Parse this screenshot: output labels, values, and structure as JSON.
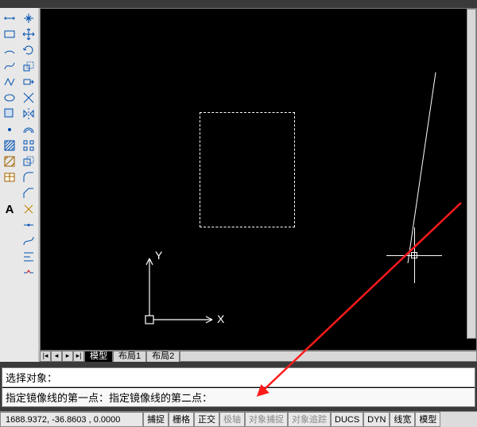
{
  "tabs": {
    "model": "模型",
    "layout1": "布局1",
    "layout2": "布局2"
  },
  "ucs": {
    "x_label": "X",
    "y_label": "Y"
  },
  "command": {
    "history1": "选择对象：",
    "prompt": "指定镜像线的第一点：指定镜像线的第二点："
  },
  "status": {
    "coords": "1688.9372, -36.8603 , 0.0000",
    "snap": "捕捉",
    "grid": "栅格",
    "ortho": "正交",
    "polar": "极轴",
    "osnap": "对象捕捉",
    "otrack": "对象追踪",
    "ducs": "DUCS",
    "dyn": "DYN",
    "lwt": "线宽",
    "model": "模型"
  },
  "nav": {
    "first": "|◂",
    "prev": "◂",
    "next": "▸",
    "last": "▸|"
  },
  "icons": {
    "col1": [
      "dim-linear",
      "rect",
      "arc",
      "spline",
      "polyline",
      "ellipse",
      "region",
      "point",
      "hatch",
      "crosshatch",
      "block",
      "text"
    ],
    "col2": [
      "pan",
      "move",
      "rotate",
      "scale",
      "stretch",
      "trim",
      "mirror",
      "offset",
      "array",
      "copy",
      "fillet",
      "chamfer",
      "explode",
      "join",
      "curve",
      "align",
      "break"
    ]
  }
}
